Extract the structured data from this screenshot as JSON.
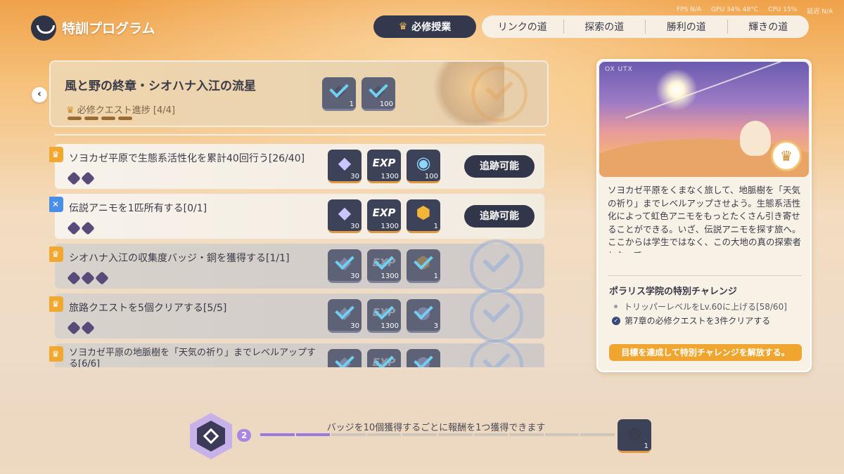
{
  "header": {
    "title": "特訓プログラム",
    "tabs": [
      {
        "label": "必修授業",
        "active": true
      },
      {
        "label": "リンクの道",
        "active": false
      },
      {
        "label": "探索の道",
        "active": false
      },
      {
        "label": "勝利の道",
        "active": false
      },
      {
        "label": "輝きの道",
        "active": false
      }
    ],
    "system": {
      "fps": "FPS N/A",
      "gpu": "GPU 34% 48°C",
      "cpu": "CPU 15%",
      "other": "延迟 N/A"
    }
  },
  "main_quest": {
    "title": "風と野の終章・シオハナ入江の流星",
    "progress_label": "必修クエスト進捗 [4/4]",
    "rewards": [
      {
        "icon": "crystal-icon",
        "qty": "1"
      },
      {
        "icon": "crystal-icon",
        "qty": "100"
      }
    ]
  },
  "quests": [
    {
      "title": "ソヨカゼ平原で生態系活性化を累計40回行う[26/40]",
      "status": "active",
      "icon": "orange",
      "hex_count": 2,
      "button": "追跡可能",
      "rewards": [
        {
          "icon": "crystal-icon",
          "glyph": "◆",
          "qty": "30"
        },
        {
          "icon": "exp-icon",
          "glyph": "EXP",
          "qty": "1300"
        },
        {
          "icon": "orb-icon",
          "glyph": "◉",
          "qty": "100"
        }
      ]
    },
    {
      "title": "伝説アニモを1匹所有する[0/1]",
      "status": "active",
      "icon": "blue",
      "hex_count": 2,
      "button": "追跡可能",
      "rewards": [
        {
          "icon": "crystal-icon",
          "glyph": "◆",
          "qty": "30"
        },
        {
          "icon": "exp-icon",
          "glyph": "EXP",
          "qty": "1300"
        },
        {
          "icon": "gem-icon",
          "glyph": "⬢",
          "qty": "1"
        }
      ]
    },
    {
      "title": "シオハナ入江の収集度バッジ・銅を獲得する[1/1]",
      "status": "done",
      "icon": "orange",
      "hex_count": 3,
      "rewards": [
        {
          "icon": "crystal-icon",
          "glyph": "◆",
          "qty": "30"
        },
        {
          "icon": "exp-icon",
          "glyph": "EXP",
          "qty": "1300"
        },
        {
          "icon": "gem-icon",
          "glyph": "⬢",
          "qty": "1"
        }
      ]
    },
    {
      "title": "旅路クエストを5個クリアする[5/5]",
      "status": "done",
      "icon": "orange",
      "hex_count": 2,
      "rewards": [
        {
          "icon": "crystal-icon",
          "glyph": "◆",
          "qty": "30"
        },
        {
          "icon": "exp-icon",
          "glyph": "EXP",
          "qty": "1300"
        },
        {
          "icon": "pouch-icon",
          "glyph": "●",
          "qty": "3"
        }
      ]
    },
    {
      "title": "ソヨカゼ平原の地脈樹を「天気の祈り」までレベルアップする[6/6]",
      "status": "done",
      "icon": "orange",
      "hex_count": 2,
      "rewards": [
        {
          "icon": "crystal-icon",
          "glyph": "◆",
          "qty": ""
        },
        {
          "icon": "exp-icon",
          "glyph": "EXP",
          "qty": ""
        },
        {
          "icon": "pouch-icon",
          "glyph": "●",
          "qty": ""
        }
      ]
    }
  ],
  "panel": {
    "tag": "OX UTX",
    "description": "ソヨカゼ平原をくまなく旅して、地脈樹を「天気の祈り」までレベルアップさせよう。生態系活性化によって虹色アニモをもっとたくさん引き寄せることができる。いざ、伝説アニモを探す旅へ。ここからは学生ではなく、この大地の真の探索者となって",
    "challenge_title": "ポラリス学院の特別チャレンジ",
    "challenge_items": [
      {
        "text": "トリッパーレベルをLv.60に上げる[58/60]",
        "done": false
      },
      {
        "text": "第7章の必修クエストを3件クリアする",
        "done": true
      }
    ],
    "goal_button": "目標を達成して特別チャレンジを解放する。"
  },
  "bottom": {
    "badge_count": "2",
    "text": "バッジを10個獲得するごとに報酬を1つ獲得できます",
    "segments_total": 10,
    "segments_filled": 2,
    "reward_qty": "1"
  },
  "colors": {
    "accent": "#f0a52e",
    "dark": "#33384d",
    "progress": "#9a7ae0"
  }
}
